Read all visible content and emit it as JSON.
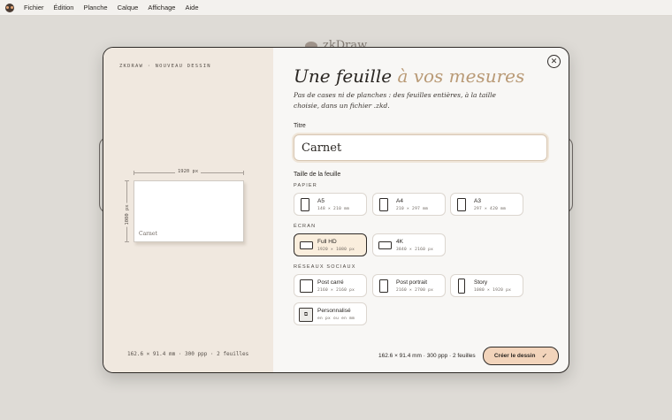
{
  "menubar": {
    "items": [
      "Fichier",
      "Édition",
      "Planche",
      "Calque",
      "Affichage",
      "Aide"
    ]
  },
  "background": {
    "logo_text": "zkDraw"
  },
  "preview": {
    "eyebrow": "ZKDRAW · NOUVEAU DESSIN",
    "width_label": "1920 px",
    "height_label": "1080 px",
    "sheet_label": "Carnet",
    "summary": "162.6 × 91.4 mm · 300 ppp · 2 feuilles"
  },
  "form": {
    "headline_main": "Une feuille ",
    "headline_accent": "à vos mesures",
    "lede": "Pas de cases ni de planches : des feuilles entières, à la taille choisie, dans un fichier .zkd.",
    "title_label": "Titre",
    "title_value": "Carnet",
    "size_label": "Taille de la feuille",
    "groups": {
      "paper": "PAPIER",
      "screen": "ÉCRAN",
      "social": "RÉSEAUX SOCIAUX"
    },
    "presets": {
      "a5": {
        "name": "A5",
        "spec": "148 × 210 mm"
      },
      "a4": {
        "name": "A4",
        "spec": "210 × 297 mm"
      },
      "a3": {
        "name": "A3",
        "spec": "297 × 420 mm"
      },
      "fullhd": {
        "name": "Full HD",
        "spec": "1920 × 1080 px",
        "selected": true
      },
      "k4": {
        "name": "4K",
        "spec": "3840 × 2160 px"
      },
      "post_square": {
        "name": "Post carré",
        "spec": "2160 × 2160 px"
      },
      "post_portrait": {
        "name": "Post portrait",
        "spec": "2160 × 2700 px"
      },
      "story": {
        "name": "Story",
        "spec": "1080 × 1920 px"
      },
      "custom": {
        "name": "Personnalisé",
        "spec": "en px ou en mm",
        "glyph": "⧉"
      }
    },
    "summary": "162.6 × 91.4 mm · 300 ppp · 2 feuilles",
    "create_label": "Créer le dessin",
    "create_icon": "check-icon"
  },
  "colors": {
    "accent": "#b99a76",
    "selected_bg": "#faeedd",
    "button_bg": "#f2d4bb",
    "left_pane": "#f0e8df"
  }
}
